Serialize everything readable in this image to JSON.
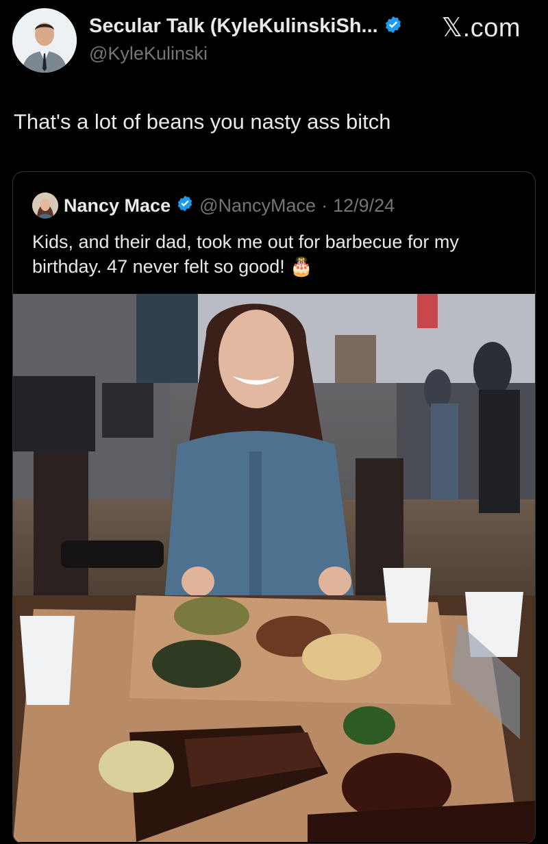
{
  "tweet": {
    "author_name": "Secular Talk (KyleKulinskiSh...",
    "author_handle": "@KyleKulinski",
    "text": "That's a lot of beans you nasty ass bitch"
  },
  "brand": "𝕏.com",
  "quoted": {
    "author_name": "Nancy Mace",
    "author_handle": "@NancyMace",
    "separator": "·",
    "date": "12/9/24",
    "text": "Kids, and their dad, took me out for barbecue for my birthday. 47 never felt so good! 🎂"
  },
  "colors": {
    "verified": "#1d9bf0",
    "background": "#000000",
    "muted": "#71767b"
  },
  "icons": {
    "verified": "verified-badge-icon"
  }
}
